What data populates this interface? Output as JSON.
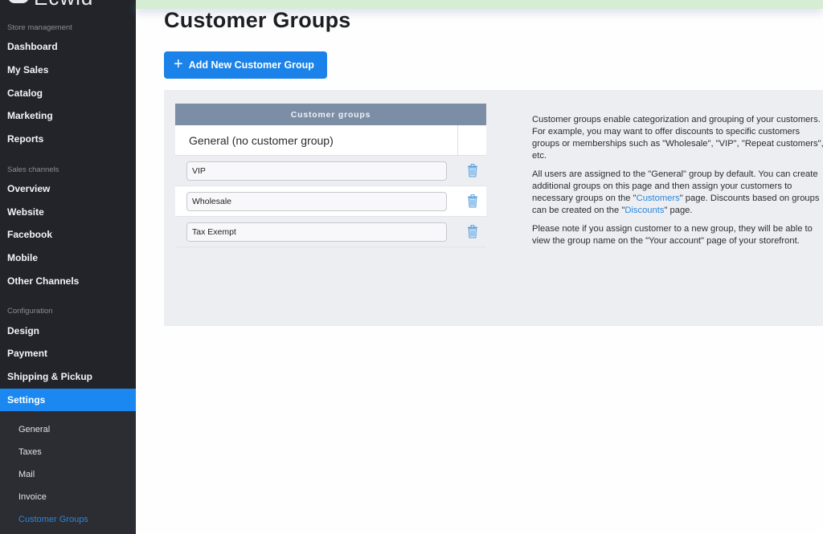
{
  "sidebar": {
    "logo_text": "Ecwid",
    "sections": {
      "store_management": "Store management",
      "sales_channels": "Sales channels",
      "configuration": "Configuration"
    },
    "items": {
      "dashboard": "Dashboard",
      "my_sales": "My Sales",
      "catalog": "Catalog",
      "marketing": "Marketing",
      "reports": "Reports",
      "overview": "Overview",
      "website": "Website",
      "facebook": "Facebook",
      "mobile": "Mobile",
      "other_channels": "Other Channels",
      "design": "Design",
      "payment": "Payment",
      "shipping": "Shipping & Pickup",
      "settings": "Settings"
    },
    "settings_sub": {
      "general": "General",
      "taxes": "Taxes",
      "mail": "Mail",
      "invoice": "Invoice",
      "customer_groups": "Customer Groups"
    },
    "active_item": "Settings",
    "active_sub_item": "Customer Groups",
    "active_color": "#1a88f0"
  },
  "main": {
    "title": "Customer Groups",
    "add_button_label": "Add New Customer Group",
    "table": {
      "header": "Customer groups",
      "default_group": "General (no customer group)",
      "groups": [
        {
          "value": "VIP"
        },
        {
          "value": "Wholesale"
        },
        {
          "value": "Tax Exempt"
        }
      ]
    },
    "info": {
      "p1": "Customer groups enable categorization and grouping of your customers. For example, you may want to offer discounts to specific customers groups or memberships such as \"Wholesale\", \"VIP\", \"Repeat customers\", etc.",
      "p2_a": "All users are assigned to the \"General\" group by default. You can create additional groups on this page and then assign your customers to necessary groups on the \"",
      "p2_link1": "Customers",
      "p2_b": "\" page. Discounts based on groups can be created on the \"",
      "p2_link2": "Discounts",
      "p2_c": "\" page.",
      "p3": "Please note if you assign customer to a new group, they will be able to view the group name on the \"Your account\" page of your storefront."
    }
  }
}
